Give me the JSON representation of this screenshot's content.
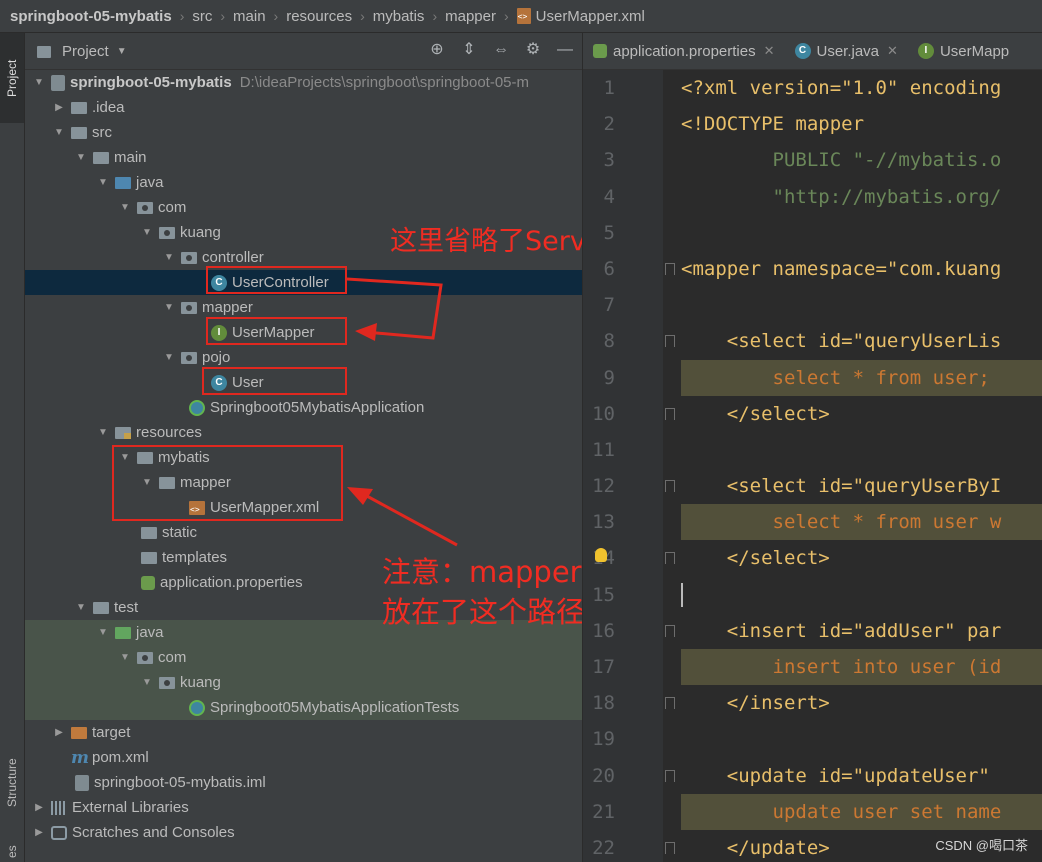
{
  "breadcrumb": [
    "springboot-05-mybatis",
    "src",
    "main",
    "resources",
    "mybatis",
    "mapper",
    "UserMapper.xml"
  ],
  "stripe": {
    "project": "Project",
    "structure": "Structure",
    "extra": "es"
  },
  "project_panel": {
    "title": "Project"
  },
  "tree": {
    "module": "springboot-05-mybatis",
    "module_path": "D:\\ideaProjects\\springboot\\springboot-05-m",
    "idea": ".idea",
    "src": "src",
    "main": "main",
    "java": "java",
    "com": "com",
    "kuang": "kuang",
    "controller": "controller",
    "user_controller": "UserController",
    "mapper_pkg": "mapper",
    "user_mapper": "UserMapper",
    "pojo": "pojo",
    "user": "User",
    "app": "Springboot05MybatisApplication",
    "resources": "resources",
    "mybatis": "mybatis",
    "mapper_dir": "mapper",
    "user_mapper_xml": "UserMapper.xml",
    "static": "static",
    "templates": "templates",
    "app_props": "application.properties",
    "test": "test",
    "test_java": "java",
    "test_com": "com",
    "test_kuang": "kuang",
    "app_tests": "Springboot05MybatisApplicationTests",
    "target": "target",
    "pom": "pom.xml",
    "iml": "springboot-05-mybatis.iml",
    "ext_libs": "External Libraries",
    "scratches": "Scratches and Consoles"
  },
  "annotations": {
    "service_note": "这里省略了Service层",
    "mapper_note_1": "注意：mapper.xml",
    "mapper_note_2": "放在了这个路径下"
  },
  "tabs": [
    {
      "label": "application.properties",
      "icon": "properties-icon"
    },
    {
      "label": "User.java",
      "icon": "class-icon"
    },
    {
      "label": "UserMapp",
      "icon": "interface-icon"
    }
  ],
  "code_lines": [
    {
      "n": "1",
      "t": "<?xml version=\"1.0\" encoding"
    },
    {
      "n": "2",
      "t": "<!DOCTYPE mapper"
    },
    {
      "n": "3",
      "t": "        PUBLIC \"-//mybatis.o"
    },
    {
      "n": "4",
      "t": "        \"http://mybatis.org/"
    },
    {
      "n": "5",
      "t": ""
    },
    {
      "n": "6",
      "t": "<mapper namespace=\"com.kuang"
    },
    {
      "n": "7",
      "t": ""
    },
    {
      "n": "8",
      "t": "    <select id=\"queryUserLis"
    },
    {
      "n": "9",
      "t": "        select * from user;"
    },
    {
      "n": "10",
      "t": "    </select>"
    },
    {
      "n": "11",
      "t": ""
    },
    {
      "n": "12",
      "t": "    <select id=\"queryUserByI"
    },
    {
      "n": "13",
      "t": "        select * from user w"
    },
    {
      "n": "14",
      "t": "    </select>"
    },
    {
      "n": "15",
      "t": ""
    },
    {
      "n": "16",
      "t": "    <insert id=\"addUser\" par"
    },
    {
      "n": "17",
      "t": "        insert into user (id"
    },
    {
      "n": "18",
      "t": "    </insert>"
    },
    {
      "n": "19",
      "t": ""
    },
    {
      "n": "20",
      "t": "    <update id=\"updateUser\" "
    },
    {
      "n": "21",
      "t": "        update user set name"
    },
    {
      "n": "22",
      "t": "    </update>"
    }
  ],
  "watermark": "CSDN @喝口茶",
  "colors": {
    "annotation_red": "#e0281f",
    "selection": "#0d293e",
    "sql_highlight": "#52503a"
  }
}
